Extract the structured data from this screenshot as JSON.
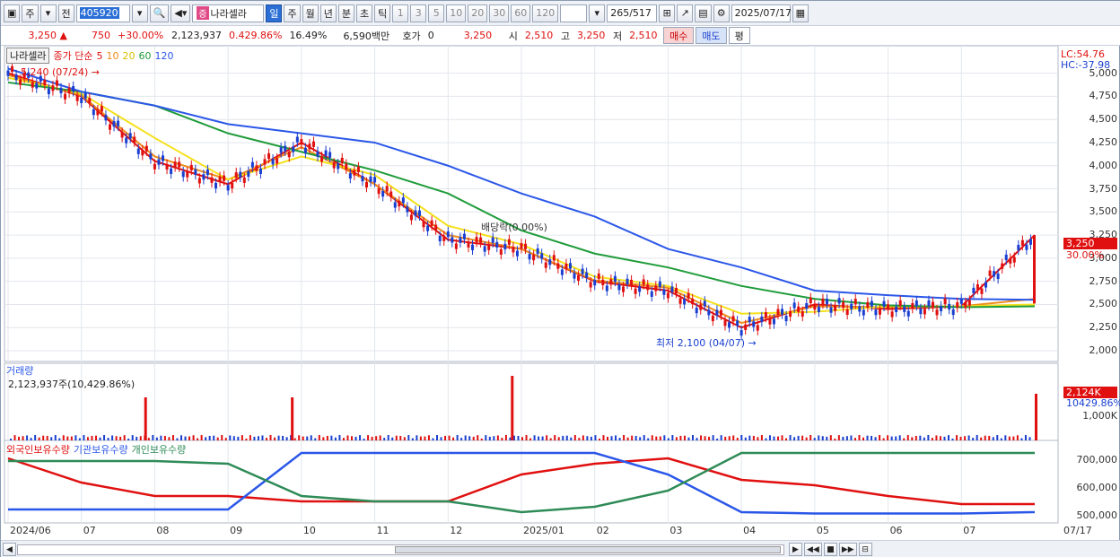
{
  "toolbar": {
    "period_prefix": "주",
    "prev_label": "전",
    "stock_code": "405920",
    "stock_tag": "증",
    "stock_name": "나라셀라",
    "period_tabs": [
      "일",
      "주",
      "월",
      "년",
      "분",
      "초",
      "틱"
    ],
    "selected_period": "일",
    "interval_buttons": [
      "1",
      "3",
      "5",
      "10",
      "20",
      "30",
      "60",
      "120"
    ],
    "count": "265",
    "total": "/517",
    "date": "2025/07/17"
  },
  "quote": {
    "price": "3,250",
    "change": "750",
    "change_pct": "+30.00%",
    "volume": "2,123,937",
    "volume_ratio": "0.429.86%",
    "turnover": "16.49%",
    "amount": "6,590백만",
    "ask_label": "호가",
    "ask_value": "0",
    "ask_price": "3,250",
    "open_label": "시",
    "open": "2,510",
    "high_label": "고",
    "high": "3,250",
    "low_label": "저",
    "low": "2,510",
    "buy_label": "매수",
    "sell_label": "매도",
    "eval_label": "평"
  },
  "price_panel": {
    "legend_name": "나라셀라",
    "legend_ma": "종가 단순",
    "ma_periods": [
      "5",
      "10",
      "20",
      "60",
      "120"
    ],
    "ma_colors": [
      "#e01010",
      "#f08c1a",
      "#f5e01a",
      "#1f9c3a",
      "#2b57e8"
    ],
    "high_annotation": "5,240 (07/24)",
    "low_annotation": "최저 2,100 (04/07)",
    "dividend_annotation": "배당락(0.00%)",
    "lc": "LC:54.76",
    "hc": "HC:-37.98",
    "price_tag": "3,250",
    "pct_tag": "30.00%",
    "y_ticks": [
      "5,000",
      "4,750",
      "4,500",
      "4,250",
      "4,000",
      "3,750",
      "3,500",
      "3,250",
      "3,000",
      "2,750",
      "2,500",
      "2,250",
      "2,000"
    ]
  },
  "volume_panel": {
    "title": "거래량",
    "value": "2,123,937주(10,429.86%)",
    "tag": "2,124K",
    "ratio_tag": "10429.86%",
    "y_tick": "1,000K"
  },
  "holding_panel": {
    "legend": [
      "외국인보유수량",
      "기관보유수량",
      "개인보유수량"
    ],
    "colors": [
      "#e01010",
      "#2b57e8",
      "#2e8b57"
    ],
    "y_ticks": [
      "700,000",
      "600,000",
      "500,000"
    ]
  },
  "x_axis": {
    "labels": [
      "2024/06",
      "07",
      "08",
      "09",
      "10",
      "11",
      "12",
      "2025/01",
      "02",
      "03",
      "04",
      "05",
      "06",
      "07",
      "07/17"
    ]
  },
  "chart_data": {
    "type": "line",
    "title": "",
    "x": [
      "2024/06",
      "2024/07",
      "2024/08",
      "2024/09",
      "2024/10",
      "2024/11",
      "2024/12",
      "2025/01",
      "2025/02",
      "2025/03",
      "2025/04",
      "2025/05",
      "2025/06",
      "2025/07",
      "2025/07/17"
    ],
    "ylim": [
      2000,
      5200
    ],
    "series": [
      {
        "name": "5",
        "values": [
          5000,
          4750,
          4050,
          3800,
          4250,
          3800,
          3200,
          3100,
          2750,
          2650,
          2250,
          2500,
          2450,
          2480,
          3250
        ]
      },
      {
        "name": "10",
        "values": [
          4980,
          4760,
          4100,
          3850,
          4200,
          3800,
          3250,
          3100,
          2760,
          2680,
          2300,
          2480,
          2470,
          2480,
          2560
        ]
      },
      {
        "name": "20",
        "values": [
          4950,
          4780,
          4300,
          3850,
          4100,
          3900,
          3350,
          3150,
          2800,
          2700,
          2400,
          2420,
          2480,
          2480,
          2500
        ]
      },
      {
        "name": "60",
        "values": [
          4900,
          4800,
          4650,
          4350,
          4150,
          3950,
          3700,
          3300,
          3050,
          2900,
          2700,
          2560,
          2490,
          2470,
          2480
        ]
      },
      {
        "name": "120",
        "values": [
          5050,
          4800,
          4650,
          4450,
          4350,
          4250,
          4000,
          3700,
          3450,
          3100,
          2900,
          2650,
          2600,
          2560,
          2550
        ]
      }
    ],
    "holding_series": [
      {
        "name": "외국인보유수량",
        "values": [
          700000,
          610000,
          560000,
          560000,
          540000,
          540000,
          540000,
          640000,
          680000,
          700000,
          620000,
          600000,
          560000,
          530000,
          530000
        ]
      },
      {
        "name": "기관보유수량",
        "values": [
          510000,
          510000,
          510000,
          510000,
          720000,
          720000,
          720000,
          720000,
          720000,
          640000,
          500000,
          495000,
          495000,
          495000,
          500000
        ]
      },
      {
        "name": "개인보유수량",
        "values": [
          690000,
          690000,
          690000,
          680000,
          560000,
          540000,
          540000,
          500000,
          520000,
          580000,
          720000,
          720000,
          720000,
          720000,
          720000
        ]
      }
    ],
    "volume_spikes": [
      {
        "x": "2024/07",
        "label": "high"
      },
      {
        "x": "2024/09",
        "label": "high"
      },
      {
        "x": "2024/12",
        "label": "highest"
      },
      {
        "x": "2025/07/17",
        "label": "2,124K"
      }
    ]
  }
}
